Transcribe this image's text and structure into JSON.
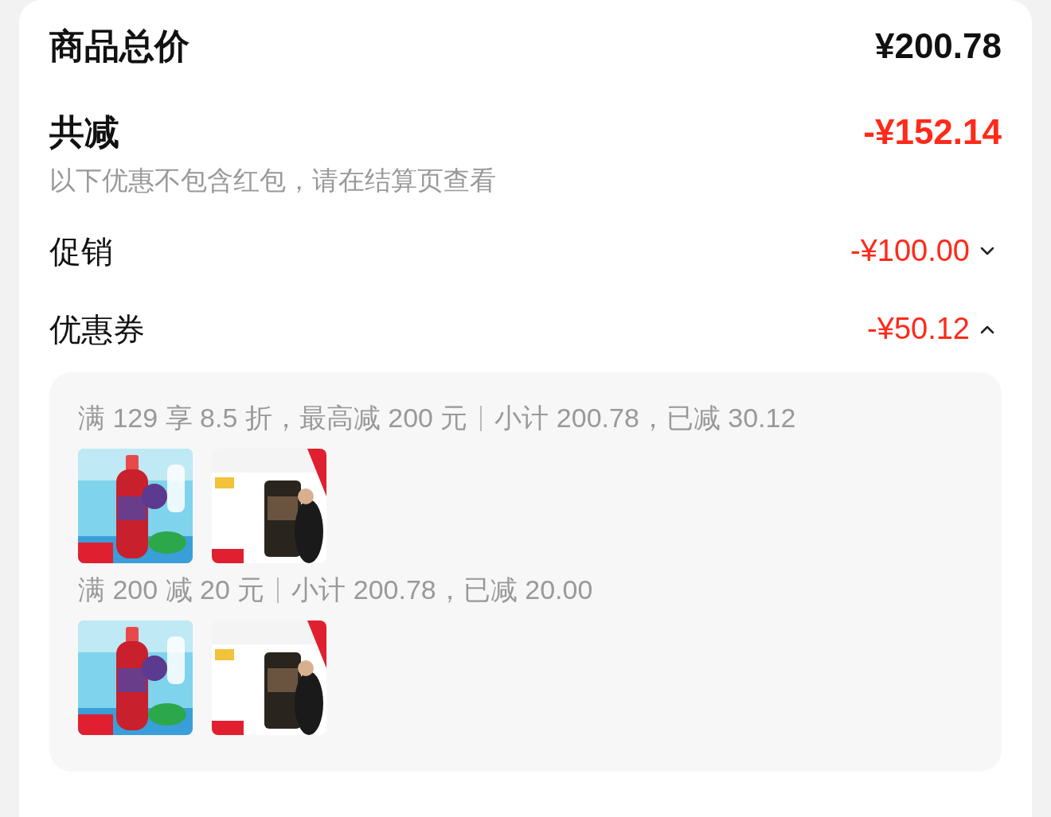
{
  "summary": {
    "label": "商品总价",
    "value": "¥200.78"
  },
  "discount_total": {
    "label": "共减",
    "value": "-¥152.14",
    "note": "以下优惠不包含红包，请在结算页查看"
  },
  "discounts": [
    {
      "label": "促销",
      "value": "-¥100.00",
      "expanded": false
    },
    {
      "label": "优惠券",
      "value": "-¥50.12",
      "expanded": true
    }
  ],
  "coupon_groups": [
    {
      "rule": "满 129 享 8.5 折，最高减 200 元",
      "subtotal": "小计 200.78，已减 30.12"
    },
    {
      "rule": "满 200 减 20 元",
      "subtotal": "小计 200.78，已减 20.00"
    }
  ]
}
